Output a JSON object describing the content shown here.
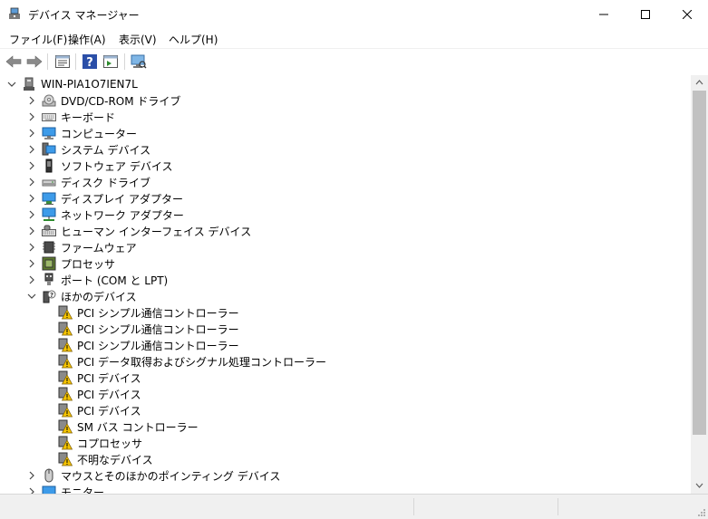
{
  "window": {
    "title": "デバイス マネージャー"
  },
  "menu": [
    "ファイル(F)",
    "操作(A)",
    "表示(V)",
    "ヘルプ(H)"
  ],
  "toolbar": [
    "back-icon",
    "forward-icon",
    "properties-icon",
    "help-icon",
    "update-driver-icon",
    "scan-hardware-icon"
  ],
  "tree": {
    "root": "WIN-PIA1O7IEN7L",
    "categories": [
      {
        "label": "DVD/CD-ROM ドライブ",
        "icon": "dvd-drive-icon"
      },
      {
        "label": "キーボード",
        "icon": "keyboard-icon"
      },
      {
        "label": "コンピューター",
        "icon": "computer-icon"
      },
      {
        "label": "システム デバイス",
        "icon": "system-devices-icon"
      },
      {
        "label": "ソフトウェア デバイス",
        "icon": "software-device-icon"
      },
      {
        "label": "ディスク ドライブ",
        "icon": "disk-drive-icon"
      },
      {
        "label": "ディスプレイ アダプター",
        "icon": "display-adapter-icon"
      },
      {
        "label": "ネットワーク アダプター",
        "icon": "network-adapter-icon"
      },
      {
        "label": "ヒューマン インターフェイス デバイス",
        "icon": "hid-icon"
      },
      {
        "label": "ファームウェア",
        "icon": "firmware-icon"
      },
      {
        "label": "プロセッサ",
        "icon": "processor-icon"
      },
      {
        "label": "ポート (COM と LPT)",
        "icon": "port-icon"
      }
    ],
    "other_devices": {
      "label": "ほかのデバイス",
      "children": [
        "PCI シンプル通信コントローラー",
        "PCI シンプル通信コントローラー",
        "PCI シンプル通信コントローラー",
        "PCI データ取得およびシグナル処理コントローラー",
        "PCI デバイス",
        "PCI デバイス",
        "PCI デバイス",
        "SM バス コントローラー",
        "コプロセッサ",
        "不明なデバイス"
      ]
    },
    "after": [
      {
        "label": "マウスとそのほかのポインティング デバイス",
        "icon": "mouse-icon"
      },
      {
        "label": "モニター",
        "icon": "monitor-icon"
      }
    ]
  }
}
